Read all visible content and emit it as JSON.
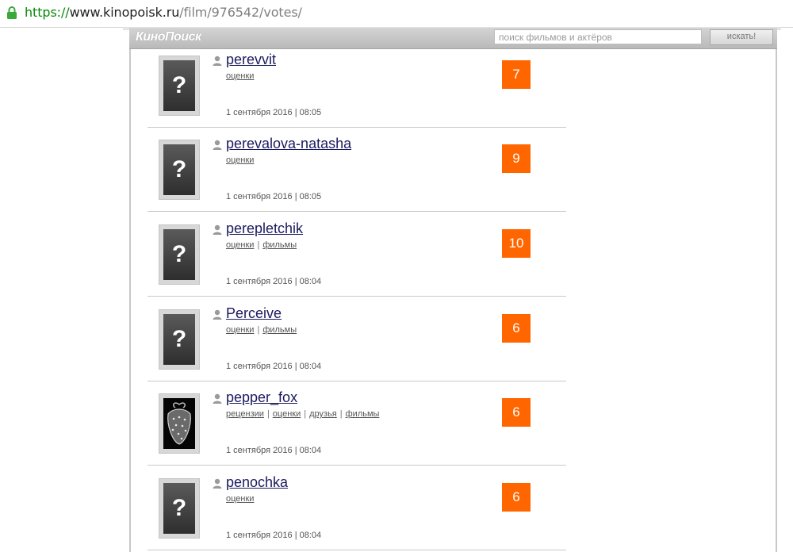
{
  "browser": {
    "url_scheme": "https://",
    "url_host": "www.kinopoisk.ru",
    "url_path": "/film/976542/votes/"
  },
  "header": {
    "logo": "КиноПоиск",
    "search_placeholder": "поиск фильмов и актёров",
    "search_button": "искать!"
  },
  "colors": {
    "score_bg": "#ff6600",
    "link": "#1a1a60"
  },
  "votes": [
    {
      "user": "perevvit",
      "links": [
        "оценки"
      ],
      "date": "1 сентября 2016 | 08:05",
      "score": "7",
      "avatar": "placeholder"
    },
    {
      "user": "perevalova-natasha",
      "links": [
        "оценки"
      ],
      "date": "1 сентября 2016 | 08:05",
      "score": "9",
      "avatar": "placeholder"
    },
    {
      "user": "perepletchik",
      "links": [
        "оценки",
        "фильмы"
      ],
      "date": "1 сентября 2016 | 08:04",
      "score": "10",
      "avatar": "placeholder"
    },
    {
      "user": "Perceive",
      "links": [
        "оценки",
        "фильмы"
      ],
      "date": "1 сентября 2016 | 08:04",
      "score": "6",
      "avatar": "placeholder"
    },
    {
      "user": "pepper_fox",
      "links": [
        "рецензии",
        "оценки",
        "друзья",
        "фильмы"
      ],
      "date": "1 сентября 2016 | 08:04",
      "score": "6",
      "avatar": "strawberry-photo"
    },
    {
      "user": "penochka",
      "links": [
        "оценки"
      ],
      "date": "1 сентября 2016 | 08:04",
      "score": "6",
      "avatar": "placeholder"
    }
  ]
}
